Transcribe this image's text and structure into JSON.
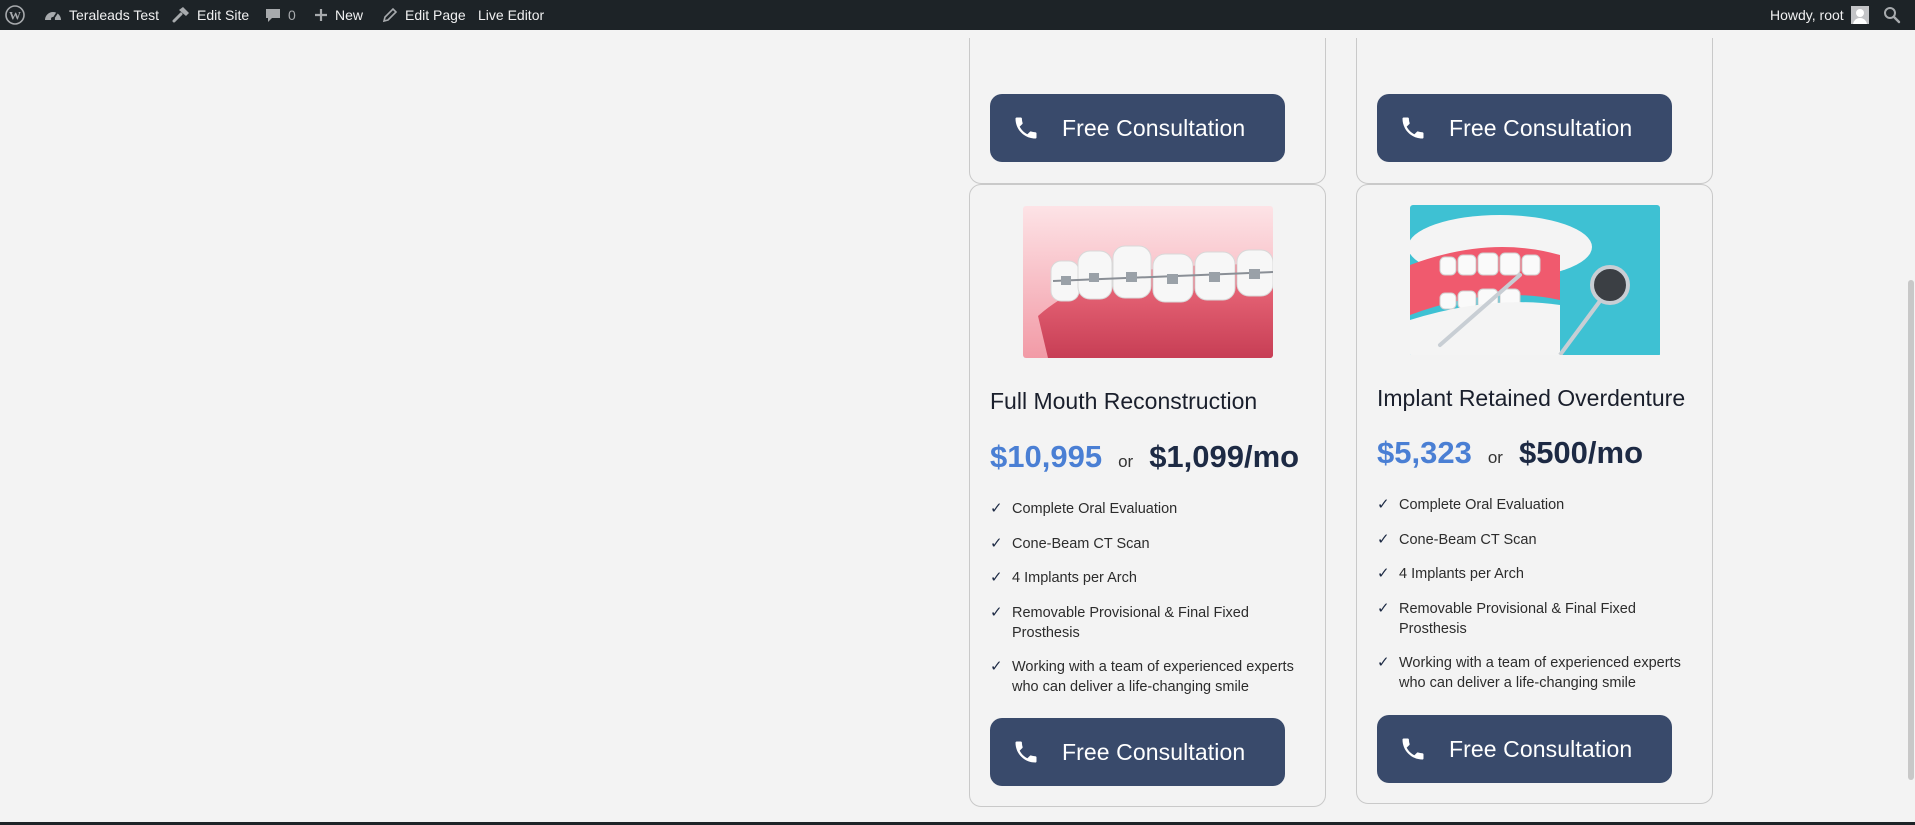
{
  "adminbar": {
    "site_name": "Teraleads Test",
    "edit_site": "Edit Site",
    "comments_count": "0",
    "new": "New",
    "edit_page": "Edit Page",
    "live_editor": "Live Editor",
    "howdy": "Howdy, root"
  },
  "cards_top": [
    {
      "cta": "Free Consultation"
    },
    {
      "cta": "Free Consultation"
    }
  ],
  "cards": [
    {
      "title": "Full Mouth Reconstruction",
      "price": "$10,995",
      "or": "or",
      "monthly": "$1,099/mo",
      "features": [
        "Complete Oral Evaluation",
        "Cone-Beam CT Scan",
        "4 Implants per Arch",
        "Removable Provisional & Final Fixed Prosthesis",
        "Working with a team of experienced experts who can deliver a life-changing smile"
      ],
      "cta": "Free Consultation"
    },
    {
      "title": "Implant Retained Overdenture",
      "price": "$5,323",
      "or": "or",
      "monthly": "$500/mo",
      "features": [
        "Complete Oral Evaluation",
        "Cone-Beam CT Scan",
        "4 Implants per Arch",
        "Removable Provisional & Final Fixed Prosthesis",
        "Working with a team of experienced experts who can deliver a life-changing smile"
      ],
      "cta": "Free Consultation"
    }
  ],
  "colors": {
    "adminbar_bg": "#1d2327",
    "page_bg": "#f3f3f3",
    "cta_bg": "#394a6b",
    "price_accent": "#4a7fd4",
    "price_dark": "#1d2a44"
  },
  "icons": [
    "wordpress-logo-icon",
    "dashboard-icon",
    "hammer-icon",
    "comment-icon",
    "plus-icon",
    "pencil-icon",
    "search-icon",
    "phone-icon",
    "check-icon"
  ]
}
